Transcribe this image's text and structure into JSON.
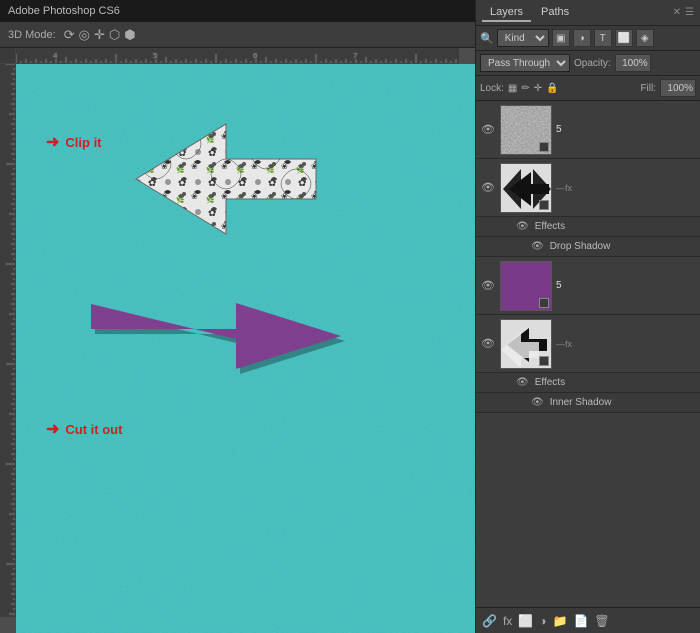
{
  "titlebar": {
    "title": "Adobe Photoshop CS6"
  },
  "toolbar": {
    "label": "3D Mode:",
    "icons": [
      "rotate-icon",
      "roll-icon",
      "pan-icon",
      "slide-icon",
      "scale-icon"
    ]
  },
  "layers_panel": {
    "tabs": [
      {
        "label": "Layers",
        "active": true
      },
      {
        "label": "Paths",
        "active": false
      }
    ],
    "kind_label": "Kind",
    "blend_mode": "Pass Through",
    "opacity_label": "Opacity:",
    "opacity_value": "100%",
    "lock_label": "Lock:",
    "fill_label": "Fill:",
    "fill_value": "100%",
    "layers": [
      {
        "id": "layer1",
        "name": "5",
        "visible": true,
        "has_effects": false,
        "thumb_type": "grainy"
      },
      {
        "id": "layer2",
        "name": "",
        "visible": true,
        "has_effects": false,
        "fx": true,
        "thumb_type": "arrow-bw"
      },
      {
        "id": "layer2-effects",
        "type": "effects-header",
        "label": "Effects"
      },
      {
        "id": "layer2-drop",
        "type": "effect",
        "label": "Drop Shadow"
      },
      {
        "id": "layer3",
        "name": "5",
        "visible": true,
        "has_effects": false,
        "thumb_type": "purple"
      },
      {
        "id": "layer4",
        "name": "",
        "visible": true,
        "has_effects": false,
        "fx": true,
        "thumb_type": "arrows-combined"
      },
      {
        "id": "layer4-effects",
        "type": "effects-header",
        "label": "Effects"
      },
      {
        "id": "layer4-inner",
        "type": "effect",
        "label": "Inner Shadow"
      }
    ],
    "bottom_icons": [
      "link-icon",
      "fx-icon",
      "adjustment-icon",
      "group-icon",
      "new-layer-icon",
      "trash-icon"
    ]
  },
  "canvas": {
    "clip_label": "Clip it",
    "cut_label": "Cut it out",
    "ruler_numbers_h": [
      "4",
      "5",
      "6",
      "7"
    ],
    "ruler_numbers_v": []
  },
  "colors": {
    "canvas_bg": "#40bfbf",
    "panel_bg": "#3d3d3d",
    "accent": "#cc2222",
    "arrow_purple": "#7a3a8a"
  }
}
